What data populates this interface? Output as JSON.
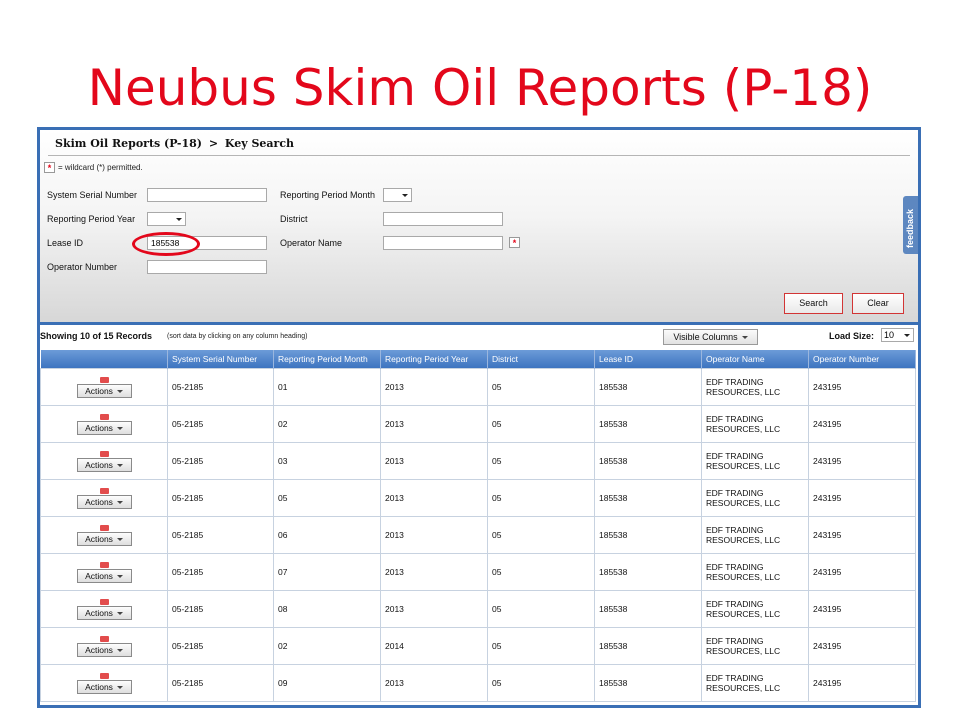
{
  "slide": {
    "title": "Neubus Skim Oil Reports (P-18)"
  },
  "breadcrumb": {
    "section": "Skim Oil Reports (P-18)",
    "separator": ">",
    "page": "Key Search"
  },
  "wildcard_note": "= wildcard (*) permitted.",
  "form": {
    "system_serial_number": {
      "label": "System Serial Number",
      "value": ""
    },
    "reporting_period_month": {
      "label": "Reporting Period Month",
      "value": ""
    },
    "reporting_period_year": {
      "label": "Reporting Period Year",
      "value": ""
    },
    "district": {
      "label": "District",
      "value": ""
    },
    "lease_id": {
      "label": "Lease ID",
      "value": "185538"
    },
    "operator_name": {
      "label": "Operator Name",
      "value": ""
    },
    "operator_number": {
      "label": "Operator Number",
      "value": ""
    },
    "search_label": "Search",
    "clear_label": "Clear"
  },
  "feedback_label": "feedback",
  "results": {
    "showing": "Showing 10 of 15 Records",
    "sort_note": "(sort data by clicking on any column heading)",
    "visible_columns_label": "Visible Columns",
    "load_size_label": "Load Size:",
    "load_size_value": "10"
  },
  "table": {
    "action_label": "Actions",
    "columns": [
      "System Serial Number",
      "Reporting Period Month",
      "Reporting Period Year",
      "District",
      "Lease ID",
      "Operator Name",
      "Operator Number"
    ],
    "rows": [
      {
        "serial": "05-2185",
        "month": "01",
        "year": "2013",
        "district": "05",
        "lease": "185538",
        "op_name_1": "EDF TRADING",
        "op_name_2": "RESOURCES, LLC",
        "op_number": "243195"
      },
      {
        "serial": "05-2185",
        "month": "02",
        "year": "2013",
        "district": "05",
        "lease": "185538",
        "op_name_1": "EDF TRADING",
        "op_name_2": "RESOURCES, LLC",
        "op_number": "243195"
      },
      {
        "serial": "05-2185",
        "month": "03",
        "year": "2013",
        "district": "05",
        "lease": "185538",
        "op_name_1": "EDF TRADING",
        "op_name_2": "RESOURCES, LLC",
        "op_number": "243195"
      },
      {
        "serial": "05-2185",
        "month": "05",
        "year": "2013",
        "district": "05",
        "lease": "185538",
        "op_name_1": "EDF TRADING",
        "op_name_2": "RESOURCES, LLC",
        "op_number": "243195"
      },
      {
        "serial": "05-2185",
        "month": "06",
        "year": "2013",
        "district": "05",
        "lease": "185538",
        "op_name_1": "EDF TRADING",
        "op_name_2": "RESOURCES, LLC",
        "op_number": "243195"
      },
      {
        "serial": "05-2185",
        "month": "07",
        "year": "2013",
        "district": "05",
        "lease": "185538",
        "op_name_1": "EDF TRADING",
        "op_name_2": "RESOURCES, LLC",
        "op_number": "243195"
      },
      {
        "serial": "05-2185",
        "month": "08",
        "year": "2013",
        "district": "05",
        "lease": "185538",
        "op_name_1": "EDF TRADING",
        "op_name_2": "RESOURCES, LLC",
        "op_number": "243195"
      },
      {
        "serial": "05-2185",
        "month": "02",
        "year": "2014",
        "district": "05",
        "lease": "185538",
        "op_name_1": "EDF TRADING",
        "op_name_2": "RESOURCES, LLC",
        "op_number": "243195"
      },
      {
        "serial": "05-2185",
        "month": "09",
        "year": "2013",
        "district": "05",
        "lease": "185538",
        "op_name_1": "EDF TRADING",
        "op_name_2": "RESOURCES, LLC",
        "op_number": "243195"
      }
    ]
  },
  "colors": {
    "title_red": "#e3071b",
    "header_blue": "#3d74c0",
    "frame_blue": "#3a6fb5"
  }
}
